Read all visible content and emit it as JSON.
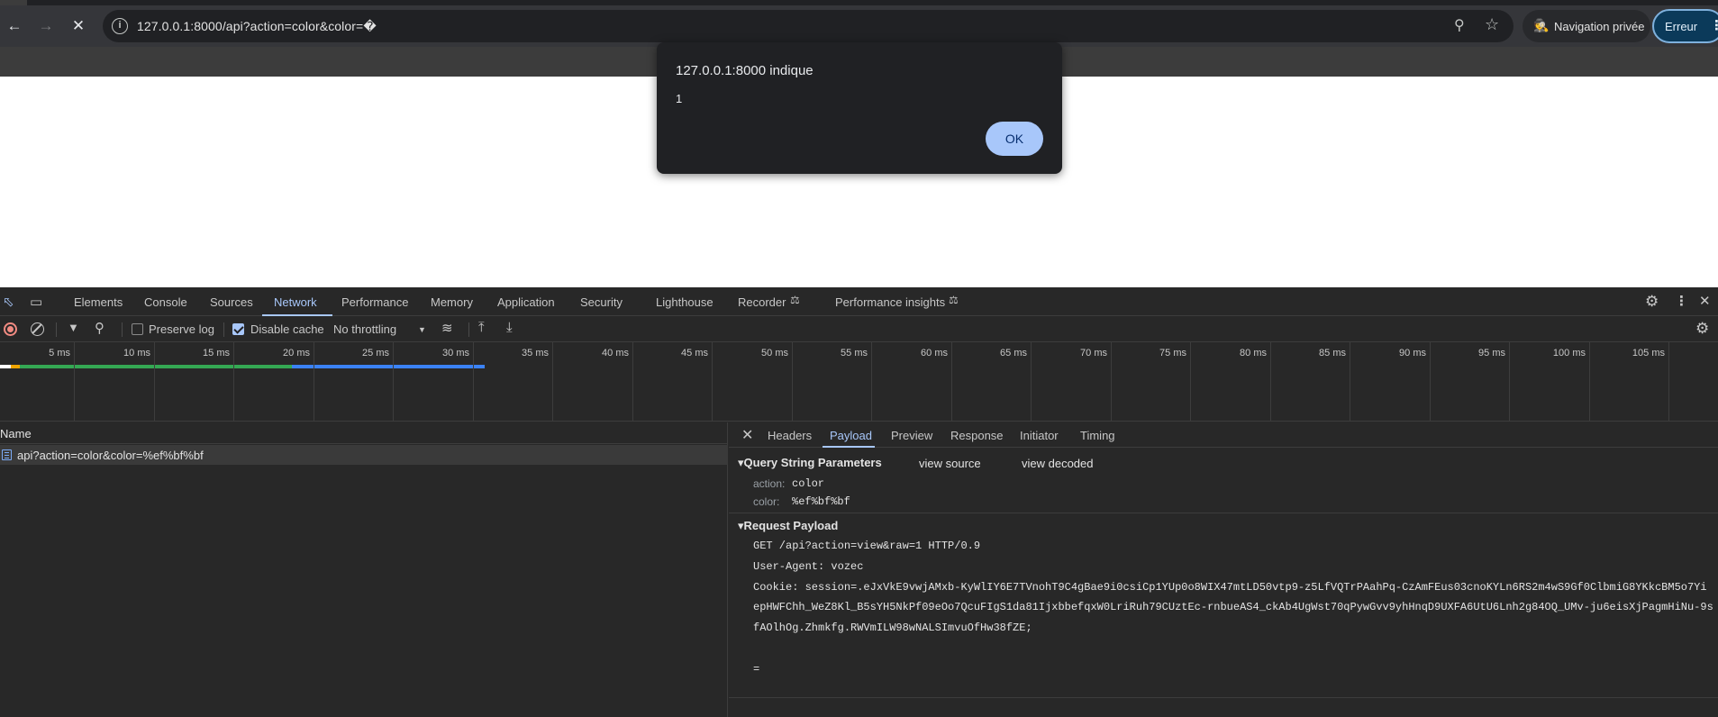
{
  "browser": {
    "url": "127.0.0.1:8000/api?action=color&color=�",
    "private_label": "Navigation privée",
    "error_label": "Erreur",
    "icons": [
      "back-arrow-icon",
      "forward-arrow-icon",
      "stop-icon",
      "info-icon",
      "zoom-icon",
      "star-icon",
      "incognito-icon",
      "more-icon"
    ]
  },
  "dialog": {
    "title": "127.0.0.1:8000 indique",
    "message": "1",
    "ok_label": "OK"
  },
  "devtools": {
    "tabs": [
      "Elements",
      "Console",
      "Sources",
      "Network",
      "Performance",
      "Memory",
      "Application",
      "Security",
      "Lighthouse",
      "Recorder",
      "Performance insights"
    ],
    "active_tab": "Network",
    "toolbar": {
      "preserve_log_label": "Preserve log",
      "preserve_log_checked": false,
      "disable_cache_label": "Disable cache",
      "disable_cache_checked": true,
      "throttling_value": "No throttling"
    },
    "timeline_ticks": [
      "5 ms",
      "10 ms",
      "15 ms",
      "20 ms",
      "25 ms",
      "30 ms",
      "35 ms",
      "40 ms",
      "45 ms",
      "50 ms",
      "55 ms",
      "60 ms",
      "65 ms",
      "70 ms",
      "75 ms",
      "80 ms",
      "85 ms",
      "90 ms",
      "95 ms",
      "100 ms",
      "105 ms"
    ],
    "requests": {
      "column_name": "Name",
      "rows": [
        {
          "name": "api?action=color&color=%ef%bf%bf"
        }
      ]
    },
    "details": {
      "tabs": [
        "Headers",
        "Payload",
        "Preview",
        "Response",
        "Initiator",
        "Timing"
      ],
      "active_tab": "Payload",
      "query_section": {
        "title": "Query String Parameters",
        "view_source": "view source",
        "view_decoded": "view decoded",
        "params": [
          {
            "key": "action:",
            "value": "color"
          },
          {
            "key": "color:",
            "value": "%ef%bf%bf"
          }
        ]
      },
      "payload_section": {
        "title": "Request Payload",
        "lines": [
          "GET /api?action=view&raw=1 HTTP/0.9",
          "User-Agent: vozec",
          "Cookie: session=.eJxVkE9vwjAMxb-KyWlIY6E7TVnohT9C4gBae9i0csiCp1YUp0o8WIX47mtLD50vtp9-z5LfVQTrPAahPq-CzAmFEus03cnoKYLn6RS2m4wS9Gf0ClbmiG8YKkcBM5o7Yi",
          "epHWFChh_WeZ8Kl_B5sYH5NkPf09eOo7QcuFIgS1da81IjxbbefqxW0LriRuh79CUztEc-rnbueAS4_ckAb4UgWst70qPywGvv9yhHnqD9UXFA6UtU6Lnh2g84OQ_UMv-ju6eisXjPagmHiNu-9s",
          "fAOlhOg.Zhmkfg.RWVmILW98wNALSImvuOfHw38fZE;",
          "",
          "="
        ]
      }
    }
  }
}
